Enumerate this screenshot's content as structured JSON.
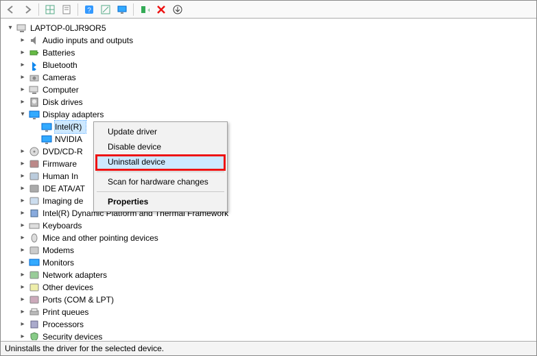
{
  "toolbar": {
    "back": "back-arrow-icon",
    "forward": "forward-arrow-icon",
    "show_hidden": "show-hidden-icon",
    "properties": "properties-icon",
    "help": "help-icon",
    "scan": "scan-icon",
    "update": "update-driver-icon",
    "add_legacy": "add-device-icon",
    "uninstall": "uninstall-icon",
    "remove": "remove-icon"
  },
  "root": {
    "label": "LAPTOP-0LJR9OR5"
  },
  "categories": [
    {
      "label": "Audio inputs and outputs",
      "expanded": false,
      "icon": "audio-icon"
    },
    {
      "label": "Batteries",
      "expanded": false,
      "icon": "battery-icon"
    },
    {
      "label": "Bluetooth",
      "expanded": false,
      "icon": "bluetooth-icon"
    },
    {
      "label": "Cameras",
      "expanded": false,
      "icon": "camera-icon"
    },
    {
      "label": "Computer",
      "expanded": false,
      "icon": "computer-icon"
    },
    {
      "label": "Disk drives",
      "expanded": false,
      "icon": "disk-icon"
    },
    {
      "label": "Display adapters",
      "expanded": true,
      "icon": "display-icon",
      "children": [
        {
          "label": "Intel(R)",
          "selected": true
        },
        {
          "label": "NVIDIA"
        }
      ]
    },
    {
      "label": "DVD/CD-R",
      "expanded": false,
      "icon": "optical-icon"
    },
    {
      "label": "Firmware",
      "expanded": false,
      "icon": "firmware-icon"
    },
    {
      "label": "Human In",
      "expanded": false,
      "icon": "hid-icon"
    },
    {
      "label": "IDE ATA/AT",
      "expanded": false,
      "icon": "ide-icon"
    },
    {
      "label": "Imaging de",
      "expanded": false,
      "icon": "imaging-icon"
    },
    {
      "label": "Intel(R) Dynamic Platform and Thermal Framework",
      "expanded": false,
      "icon": "chip-icon"
    },
    {
      "label": "Keyboards",
      "expanded": false,
      "icon": "keyboard-icon"
    },
    {
      "label": "Mice and other pointing devices",
      "expanded": false,
      "icon": "mouse-icon"
    },
    {
      "label": "Modems",
      "expanded": false,
      "icon": "modem-icon"
    },
    {
      "label": "Monitors",
      "expanded": false,
      "icon": "monitor-icon"
    },
    {
      "label": "Network adapters",
      "expanded": false,
      "icon": "network-icon"
    },
    {
      "label": "Other devices",
      "expanded": false,
      "icon": "other-icon"
    },
    {
      "label": "Ports (COM & LPT)",
      "expanded": false,
      "icon": "port-icon"
    },
    {
      "label": "Print queues",
      "expanded": false,
      "icon": "printer-icon"
    },
    {
      "label": "Processors",
      "expanded": false,
      "icon": "cpu-icon"
    },
    {
      "label": "Security devices",
      "expanded": false,
      "icon": "security-icon"
    }
  ],
  "context_menu": {
    "items": [
      {
        "label": "Update driver",
        "hover": false
      },
      {
        "label": "Disable device",
        "hover": false
      },
      {
        "label": "Uninstall device",
        "hover": true
      },
      {
        "sep": true
      },
      {
        "label": "Scan for hardware changes",
        "hover": false
      },
      {
        "sep": true
      },
      {
        "label": "Properties",
        "hover": false,
        "bold": true
      }
    ]
  },
  "statusbar": {
    "text": "Uninstalls the driver for the selected device."
  }
}
